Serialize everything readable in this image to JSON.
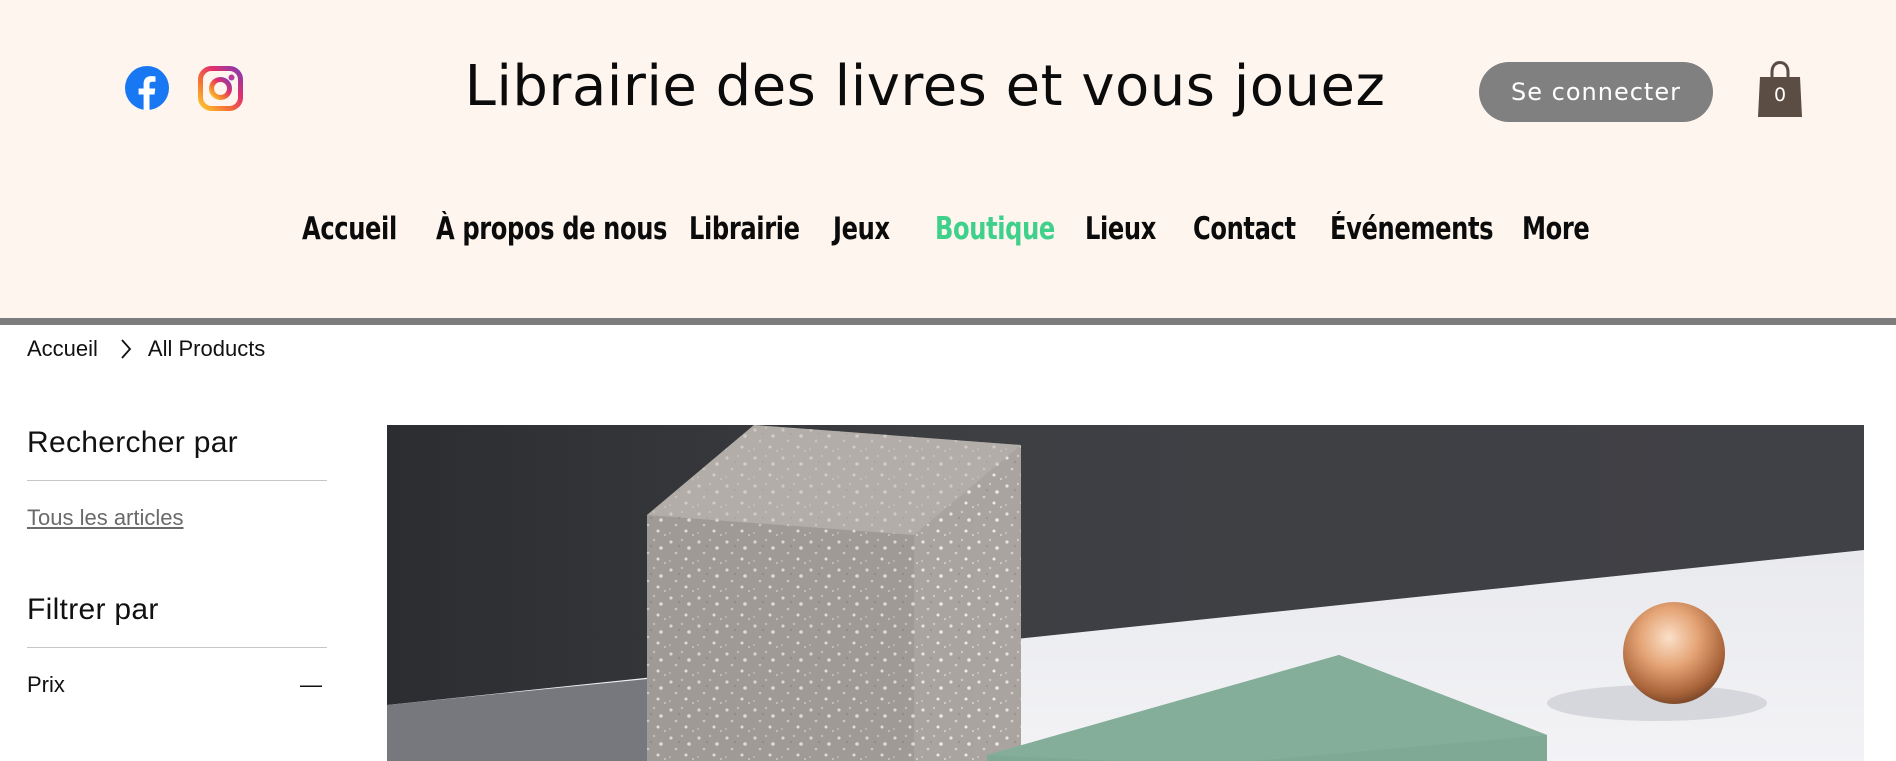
{
  "header": {
    "site_title": "Librairie des livres et vous jouez",
    "login_label": "Se connecter",
    "cart_count": "0",
    "social": [
      {
        "icon": "facebook-icon",
        "color": "#1877f2"
      },
      {
        "icon": "instagram-icon",
        "color": "#e1306c"
      }
    ]
  },
  "nav": {
    "items": [
      {
        "label": "Accueil",
        "active": false
      },
      {
        "label": "À propos de nous",
        "active": false
      },
      {
        "label": "Librairie",
        "active": false
      },
      {
        "label": "Jeux",
        "active": false
      },
      {
        "label": "Boutique",
        "active": true
      },
      {
        "label": "Lieux",
        "active": false
      },
      {
        "label": "Contact",
        "active": false
      },
      {
        "label": "Événements",
        "active": false
      },
      {
        "label": "More",
        "active": false
      }
    ],
    "active_color": "#3fd08c"
  },
  "breadcrumb": {
    "home": "Accueil",
    "current": "All Products"
  },
  "sidebar": {
    "search_heading": "Rechercher par",
    "all_items_link": "Tous les articles",
    "filter_heading": "Filtrer par",
    "price_label": "Prix",
    "price_toggle": "—"
  },
  "colors": {
    "header_bg": "#fdf5ee",
    "header_border": "#7d7d7d",
    "login_button": "#808080",
    "cart": "#5b4c44"
  }
}
